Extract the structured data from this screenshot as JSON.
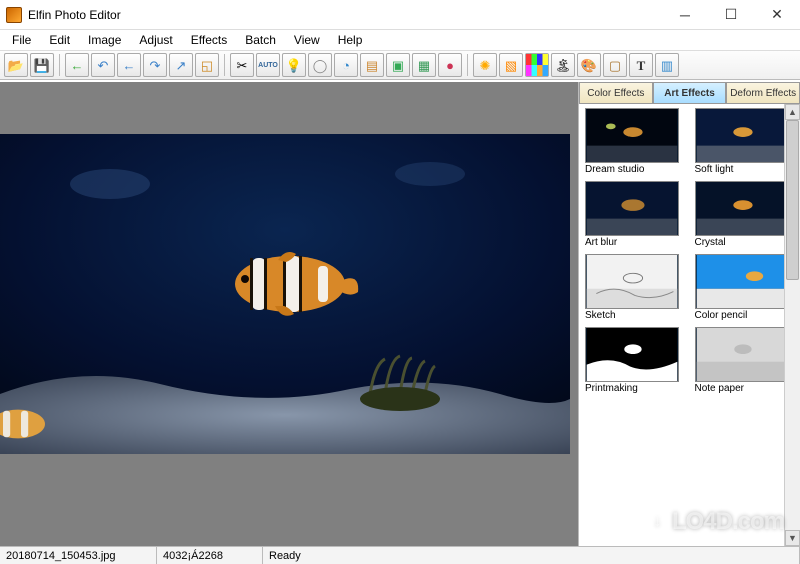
{
  "window": {
    "title": "Elfin Photo Editor"
  },
  "menu": {
    "file": "File",
    "edit": "Edit",
    "image": "Image",
    "adjust": "Adjust",
    "effects": "Effects",
    "batch": "Batch",
    "view": "View",
    "help": "Help"
  },
  "toolbar_icons": {
    "open": "📂",
    "save": "💾",
    "undo_left": "←",
    "rotate_ccw": "↶",
    "undo_alt": "←",
    "rotate_cw": "↷",
    "redo_alt": "↗",
    "fit": "◱",
    "crop": "✂",
    "auto": "AUTO",
    "bulb_on": "💡",
    "bulb_off": "◯",
    "piechart": "◔",
    "levels": "▤",
    "box_plus": "▣",
    "layers": "▦",
    "sphere": "●",
    "starburst": "✺",
    "color_sq": "▧",
    "rainbow": "▦",
    "scene": "🏝",
    "palette": "🎨",
    "frame": "▢",
    "text": "T",
    "panels": "▥"
  },
  "side": {
    "tab_color": "Color Effects",
    "tab_art": "Art Effects",
    "tab_deform": "Deform Effects",
    "effects": [
      {
        "label": "Dream studio"
      },
      {
        "label": "Soft light"
      },
      {
        "label": "Art blur"
      },
      {
        "label": "Crystal"
      },
      {
        "label": "Sketch"
      },
      {
        "label": "Color pencil"
      },
      {
        "label": "Printmaking"
      },
      {
        "label": "Note paper"
      }
    ]
  },
  "status": {
    "filename": "20180714_150453.jpg",
    "dimensions": "4032¡Á2268",
    "state": "Ready"
  },
  "watermark": "LO4D.com"
}
